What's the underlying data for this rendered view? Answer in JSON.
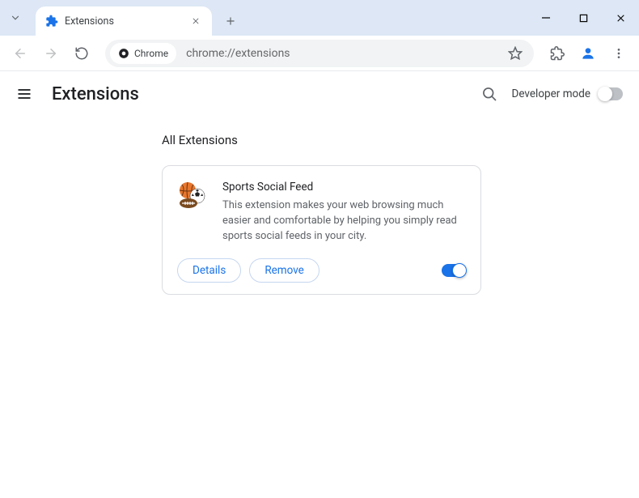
{
  "browser": {
    "tab": {
      "title": "Extensions"
    },
    "omnibox": {
      "chip_label": "Chrome",
      "url": "chrome://extensions"
    }
  },
  "page": {
    "title": "Extensions",
    "dev_mode_label": "Developer mode",
    "section_title": "All Extensions",
    "extension": {
      "name": "Sports Social Feed",
      "description": "This extension makes your web browsing much easier and comfortable by helping you simply read sports social feeds in your city.",
      "details_label": "Details",
      "remove_label": "Remove"
    }
  }
}
